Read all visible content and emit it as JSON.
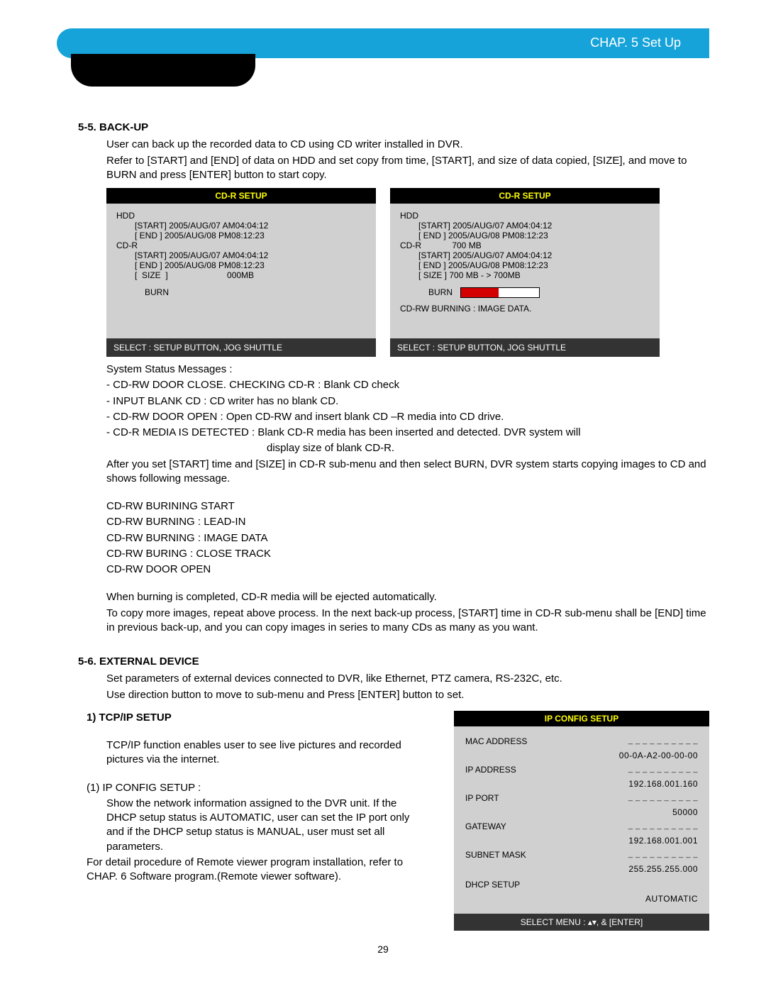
{
  "header": {
    "chapter": "CHAP. 5   Set Up"
  },
  "s55": {
    "title": "5-5. BACK-UP",
    "p1": "User can back up the recorded data to CD using CD writer installed in DVR.",
    "p2": "Refer to [START] and [END] of data on HDD and set copy from time, [START], and size of data copied, [SIZE], and move to BURN and press [ENTER] button to start copy."
  },
  "panelA": {
    "title": "CD-R SETUP",
    "hdd": "HDD",
    "hdd_start": "[START] 2005/AUG/07 AM04:04:12",
    "hdd_end": "[  END  ] 2005/AUG/08 PM08:12:23",
    "cdr": "CD-R",
    "cdr_start": "[START] 2005/AUG/07 AM04:04:12",
    "cdr_end": "[  END  ] 2005/AUG/08 PM08:12:23",
    "cdr_size": "[  SIZE  ]                         000MB",
    "burn": "BURN",
    "footer": "SELECT : SETUP BUTTON, JOG SHUTTLE"
  },
  "panelB": {
    "title": "CD-R SETUP",
    "hdd": "HDD",
    "hdd_start": "[START] 2005/AUG/07 AM04:04:12",
    "hdd_end": "[  END  ] 2005/AUG/08 PM08:12:23",
    "cdr": "CD-R             700 MB",
    "cdr_start": "[START] 2005/AUG/07 AM04:04:12",
    "cdr_end": "[  END  ] 2005/AUG/08 PM08:12:23",
    "cdr_size": "[ SIZE  ] 700 MB - >  700MB",
    "burn": "BURN",
    "status": "CD-RW BURNING : IMAGE DATA.",
    "footer": "SELECT : SETUP BUTTON, JOG SHUTTLE"
  },
  "msgs": {
    "h": "System Status Messages :",
    "m1": "- CD-RW DOOR CLOSE. CHECKING CD-R : Blank CD check",
    "m2": "- INPUT BLANK CD : CD writer has no blank CD.",
    "m3": "- CD-RW DOOR OPEN : Open CD-RW and insert blank CD –R media into CD drive.",
    "m4": "- CD-R MEDIA IS DETECTED : Blank CD-R media has been inserted and detected. DVR system will",
    "m4b": "display size of blank CD-R.",
    "after": "After you set [START] time and [SIZE] in CD-R sub-menu and then select BURN, DVR system starts copying images to CD and shows following message.",
    "b1": "CD-RW BURINING  START",
    "b2": "CD-RW BURNING : LEAD-IN",
    "b3": "CD-RW BURNING : IMAGE DATA",
    "b4": "CD-RW BURING : CLOSE TRACK",
    "b5": "CD-RW DOOR OPEN",
    "done": "When burning is completed, CD-R media will be ejected automatically.",
    "next": "To copy more images, repeat above process. In the next back-up process, [START] time in CD-R sub-menu shall be [END] time in previous back-up, and you can copy images in series to many CDs as many as you want."
  },
  "s56": {
    "title": "5-6. EXTERNAL DEVICE",
    "p1": "Set parameters of external devices connected to DVR, like Ethernet, PTZ camera, RS-232C, etc.",
    "p2": "Use direction button to move to sub-menu and Press [ENTER] button to set."
  },
  "tcp": {
    "title": "1) TCP/IP SETUP",
    "p1": "TCP/IP function enables user to see live pictures and recorded pictures via the internet.",
    "p2h": "(1) IP CONFIG SETUP :",
    "p2": "Show the network information assigned to the DVR unit. If the DHCP setup status is AUTOMATIC, user can set the IP port only and if the DHCP setup status is MANUAL, user must set all parameters.",
    "p3": "For detail procedure of Remote viewer program installation, refer to CHAP. 6 Software program.(Remote viewer software)."
  },
  "ip": {
    "title": "IP CONFIG SETUP",
    "dashes": "_ _ _ _ _ _ _ _ _ _",
    "mac_l": "MAC ADDRESS",
    "mac_v": "00-0A-A2-00-00-00",
    "ipa_l": "IP ADDRESS",
    "ipa_v": "192.168.001.160",
    "port_l": "IP PORT",
    "port_v": "50000",
    "gw_l": "GATEWAY",
    "gw_v": "192.168.001.001",
    "sm_l": "SUBNET MASK",
    "sm_v": "255.255.255.000",
    "dhcp_l": "DHCP SETUP",
    "dhcp_v": "AUTOMATIC",
    "footer": "SELECT MENU : ▴▾, & [ENTER]"
  },
  "page_num": "29"
}
